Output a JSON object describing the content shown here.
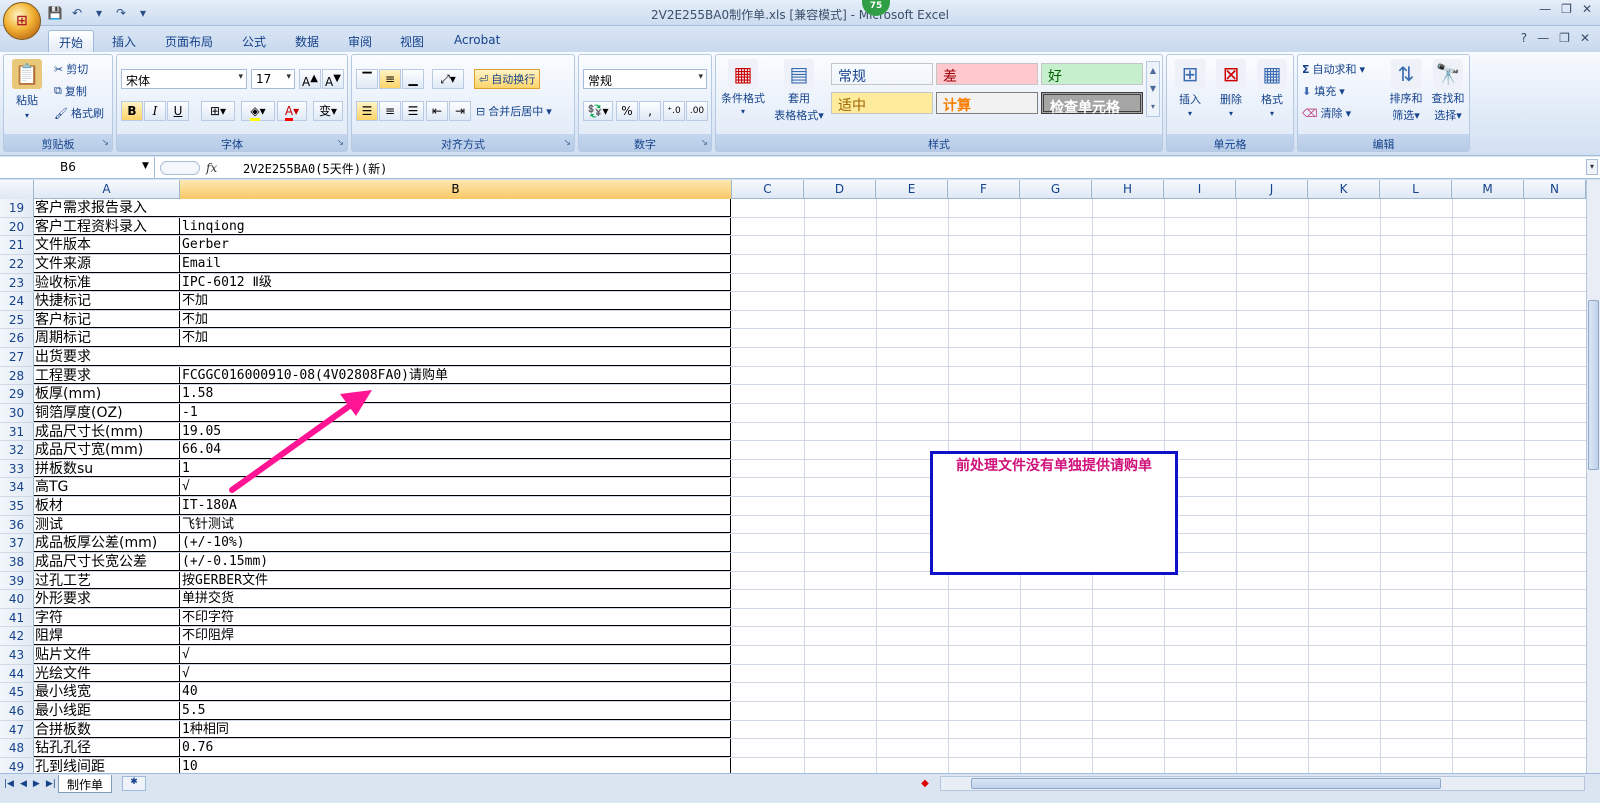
{
  "window": {
    "title": "2V2E255BA0制作单.xls  [兼容模式] - Microsoft Excel",
    "zoom_badge": "75"
  },
  "ribbon_tabs": [
    "开始",
    "插入",
    "页面布局",
    "公式",
    "数据",
    "审阅",
    "视图",
    "Acrobat"
  ],
  "ribbon": {
    "clipboard": {
      "label": "剪贴板",
      "paste": "粘贴",
      "cut": "剪切",
      "copy": "复制",
      "format_painter": "格式刷"
    },
    "font": {
      "label": "字体",
      "name": "宋体",
      "size": "17",
      "bold": "B",
      "italic": "I",
      "underline": "U"
    },
    "alignment": {
      "label": "对齐方式",
      "wrap": "自动换行",
      "merge": "合并后居中"
    },
    "number": {
      "label": "数字",
      "format": "常规",
      "percent": "%",
      "comma": ","
    },
    "styles": {
      "label": "样式",
      "conditional": "条件格式",
      "table": "套用",
      "table2": "表格格式",
      "cells": [
        {
          "name": "常规",
          "bg": "#ffffff",
          "fg": "#000000"
        },
        {
          "name": "差",
          "bg": "#ffc7ce",
          "fg": "#9c0006"
        },
        {
          "name": "好",
          "bg": "#c6efce",
          "fg": "#006100"
        },
        {
          "name": "适中",
          "bg": "#ffeb9c",
          "fg": "#9c6500"
        },
        {
          "name": "计算",
          "bg": "#f2f2f2",
          "fg": "#fa7d00"
        },
        {
          "name": "检查单元格",
          "bg": "#a5a5a5",
          "fg": "#ffffff"
        }
      ]
    },
    "cells": {
      "label": "单元格",
      "insert": "插入",
      "delete": "删除",
      "format": "格式"
    },
    "editing": {
      "label": "编辑",
      "autosum": "自动求和",
      "fill": "填充",
      "clear": "清除",
      "sort": "排序和",
      "sort2": "筛选",
      "find": "查找和",
      "find2": "选择"
    }
  },
  "formula_bar": {
    "name_box": "B6",
    "fx": "fx",
    "formula": "2V2E255BA0(5天件)(新)"
  },
  "columns": [
    "A",
    "B",
    "C",
    "D",
    "E",
    "F",
    "G",
    "H",
    "I",
    "J",
    "K",
    "L",
    "M",
    "N"
  ],
  "rows": [
    {
      "n": "19",
      "a": "客户需求报告录入",
      "b": ""
    },
    {
      "n": "20",
      "a": "客户工程资料录入",
      "b": "linqiong"
    },
    {
      "n": "21",
      "a": "文件版本",
      "b": "Gerber"
    },
    {
      "n": "22",
      "a": "文件来源",
      "b": "Email"
    },
    {
      "n": "23",
      "a": "验收标准",
      "b": "IPC-6012 Ⅱ级"
    },
    {
      "n": "24",
      "a": "快捷标记",
      "b": "不加"
    },
    {
      "n": "25",
      "a": "客户标记",
      "b": "不加"
    },
    {
      "n": "26",
      "a": "周期标记",
      "b": "不加"
    },
    {
      "n": "27",
      "a": "出货要求",
      "b": ""
    },
    {
      "n": "28",
      "a": "工程要求",
      "b": "FCGGC016000910-08(4V02808FA0)请购单"
    },
    {
      "n": "29",
      "a": "板厚(mm)",
      "b": "1.58"
    },
    {
      "n": "30",
      "a": "铜箔厚度(OZ)",
      "b": "-1"
    },
    {
      "n": "31",
      "a": "成品尺寸长(mm)",
      "b": "19.05"
    },
    {
      "n": "32",
      "a": "成品尺寸宽(mm)",
      "b": "66.04"
    },
    {
      "n": "33",
      "a": "拼板数su",
      "b": "1"
    },
    {
      "n": "34",
      "a": "高TG",
      "b": "√"
    },
    {
      "n": "35",
      "a": "板材",
      "b": "IT-180A"
    },
    {
      "n": "36",
      "a": "测试",
      "b": "飞针测试"
    },
    {
      "n": "37",
      "a": "成品板厚公差(mm)",
      "b": "(+/-10%)"
    },
    {
      "n": "38",
      "a": "成品尺寸长宽公差",
      "b": "(+/-0.15mm)"
    },
    {
      "n": "39",
      "a": "过孔工艺",
      "b": "按GERBER文件"
    },
    {
      "n": "40",
      "a": "外形要求",
      "b": "单拼交货"
    },
    {
      "n": "41",
      "a": "字符",
      "b": "不印字符"
    },
    {
      "n": "42",
      "a": "阻焊",
      "b": "不印阻焊"
    },
    {
      "n": "43",
      "a": "贴片文件",
      "b": "√"
    },
    {
      "n": "44",
      "a": "光绘文件",
      "b": "√"
    },
    {
      "n": "45",
      "a": "最小线宽",
      "b": "40"
    },
    {
      "n": "46",
      "a": "最小线距",
      "b": "5.5"
    },
    {
      "n": "47",
      "a": "合拼板数",
      "b": "1种相同"
    },
    {
      "n": "48",
      "a": "钻孔孔径",
      "b": "0.76"
    },
    {
      "n": "49",
      "a": "孔到线间距",
      "b": "10"
    }
  ],
  "note": "前处理文件没有单独提供请购单",
  "sheet_tab": "制作单"
}
